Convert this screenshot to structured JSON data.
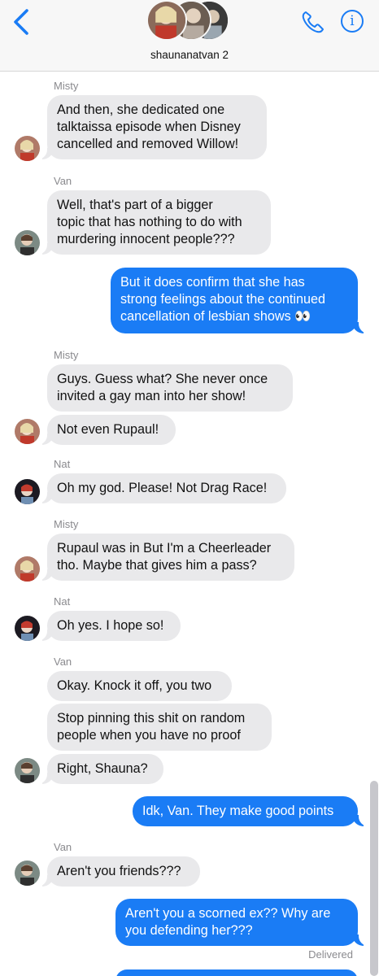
{
  "header": {
    "group_name": "shaunanatvan 2",
    "colors": {
      "accent": "#1a7cf5",
      "incoming": "#e9e9eb",
      "outgoing": "#1a7cf5"
    }
  },
  "messages": [
    {
      "sender": "Misty",
      "text": "And then, she dedicated one\ntalktaissa episode when Disney\ncancelled and removed Willow!",
      "direction": "in"
    },
    {
      "sender": "Van",
      "text": "Well, that's part of a bigger\ntopic that has nothing to do with\nmurdering innocent  people???",
      "direction": "in"
    },
    {
      "text": "But it does confirm that she has\nstrong feelings about the continued\ncancellation  of lesbian shows 👀",
      "direction": "out"
    },
    {
      "sender": "Misty",
      "text": "Guys. Guess what? She never once\ninvited a gay man into her show!",
      "direction": "in"
    },
    {
      "text": "Not even Rupaul!",
      "direction": "in"
    },
    {
      "sender": "Nat",
      "text": "Oh my god. Please! Not Drag Race!",
      "direction": "in"
    },
    {
      "sender": "Misty",
      "text": "Rupaul was in But I'm a Cheerleader\ntho. Maybe that gives him a pass?",
      "direction": "in"
    },
    {
      "sender": "Nat",
      "text": "Oh yes. I hope so!",
      "direction": "in"
    },
    {
      "sender": "Van",
      "text": "Okay. Knock it off, you two",
      "direction": "in"
    },
    {
      "text": "Stop pinning this shit on random\npeople when you have no proof",
      "direction": "in"
    },
    {
      "text": "Right, Shauna?",
      "direction": "in"
    },
    {
      "text": "Idk, Van. They make good points",
      "direction": "out"
    },
    {
      "sender": "Van",
      "text": "Aren't you friends???",
      "direction": "in"
    },
    {
      "text": "Aren't you a scorned ex?? Why are\nyou defending her???",
      "direction": "out"
    }
  ],
  "status": "Delivered"
}
